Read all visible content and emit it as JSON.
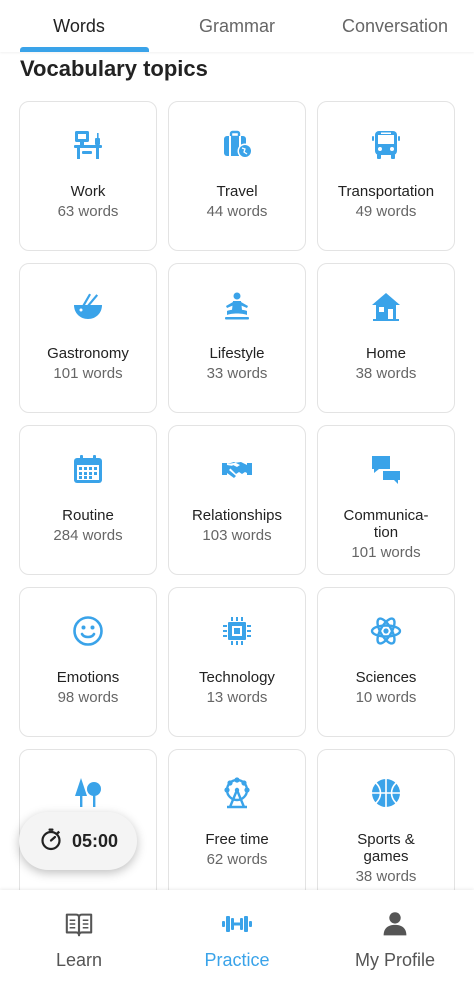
{
  "tabs": [
    {
      "label": "Words",
      "active": true
    },
    {
      "label": "Grammar",
      "active": false
    },
    {
      "label": "Conversation",
      "active": false
    }
  ],
  "section_title": "Vocabulary topics",
  "accent_color": "#3aa3e9",
  "topics": [
    {
      "name": "Work",
      "count": "63 words",
      "icon": "desk-icon"
    },
    {
      "name": "Travel",
      "count": "44 words",
      "icon": "luggage-icon"
    },
    {
      "name": "Transportation",
      "count": "49 words",
      "icon": "bus-icon"
    },
    {
      "name": "Gastronomy",
      "count": "101 words",
      "icon": "bowl-chopsticks-icon"
    },
    {
      "name": "Lifestyle",
      "count": "33 words",
      "icon": "meditation-icon"
    },
    {
      "name": "Home",
      "count": "38 words",
      "icon": "house-icon"
    },
    {
      "name": "Routine",
      "count": "284 words",
      "icon": "calendar-icon"
    },
    {
      "name": "Relationships",
      "count": "103 words",
      "icon": "handshake-icon"
    },
    {
      "name": "Communica-\ntion",
      "count": "101 words",
      "icon": "chat-bubbles-icon"
    },
    {
      "name": "Emotions",
      "count": "98 words",
      "icon": "smiley-icon"
    },
    {
      "name": "Technology",
      "count": "13 words",
      "icon": "chip-icon"
    },
    {
      "name": "Sciences",
      "count": "10 words",
      "icon": "atom-icon"
    },
    {
      "name": "",
      "count": "",
      "icon": "trees-icon"
    },
    {
      "name": "Free time",
      "count": "62 words",
      "icon": "ferris-wheel-icon"
    },
    {
      "name": "Sports &\ngames",
      "count": "38 words",
      "icon": "basketball-icon"
    }
  ],
  "timer": {
    "time": "05:00",
    "icon": "stopwatch-icon"
  },
  "bottom_nav": [
    {
      "label": "Learn",
      "icon": "book-icon",
      "active": false
    },
    {
      "label": "Practice",
      "icon": "dumbbell-icon",
      "active": true
    },
    {
      "label": "My Profile",
      "icon": "person-icon",
      "active": false
    }
  ]
}
